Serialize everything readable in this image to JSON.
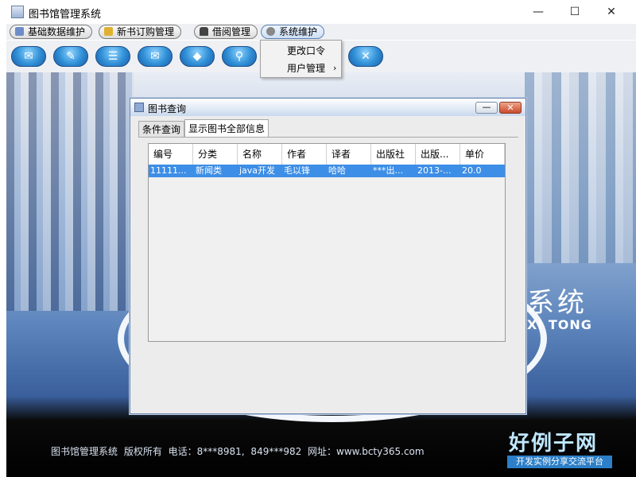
{
  "window": {
    "title": "图书馆管理系统",
    "min": "—",
    "max": "☐",
    "close": "✕"
  },
  "menubar": [
    {
      "label": "基础数据维护"
    },
    {
      "label": "新书订购管理"
    },
    {
      "label": "借阅管理"
    },
    {
      "label": "系统维护"
    }
  ],
  "toolbar_glyphs": [
    "✉",
    "✎",
    "☰",
    "✉",
    "◆",
    "⚲",
    "✕"
  ],
  "dropdown": {
    "items": [
      "更改口令",
      "用户管理"
    ],
    "submenu_arrow": "›"
  },
  "internal_frame": {
    "title": "图书查询",
    "minimize": "—",
    "close": "✕",
    "tabs": [
      "条件查询",
      "显示图书全部信息"
    ],
    "columns": [
      "编号",
      "分类",
      "名称",
      "作者",
      "译者",
      "出版社",
      "出版...",
      "单价"
    ],
    "rows": [
      [
        "11111...",
        "新闻类",
        "java开发",
        "毛以锋",
        "哈哈",
        "***出...",
        "2013-...",
        "20.0"
      ]
    ]
  },
  "background": {
    "deco_text": "系统",
    "deco_sub": "XI TONG",
    "footer": "图书馆管理系统  版权所有  电话：8***8981, 849***982  网址：www.bcty365.com",
    "watermark_logo": "好例子网",
    "watermark_sub": "开发实例分享交流平台"
  },
  "colors": {
    "selection": "#3d8ee6",
    "accent": "#2f8fd6"
  }
}
